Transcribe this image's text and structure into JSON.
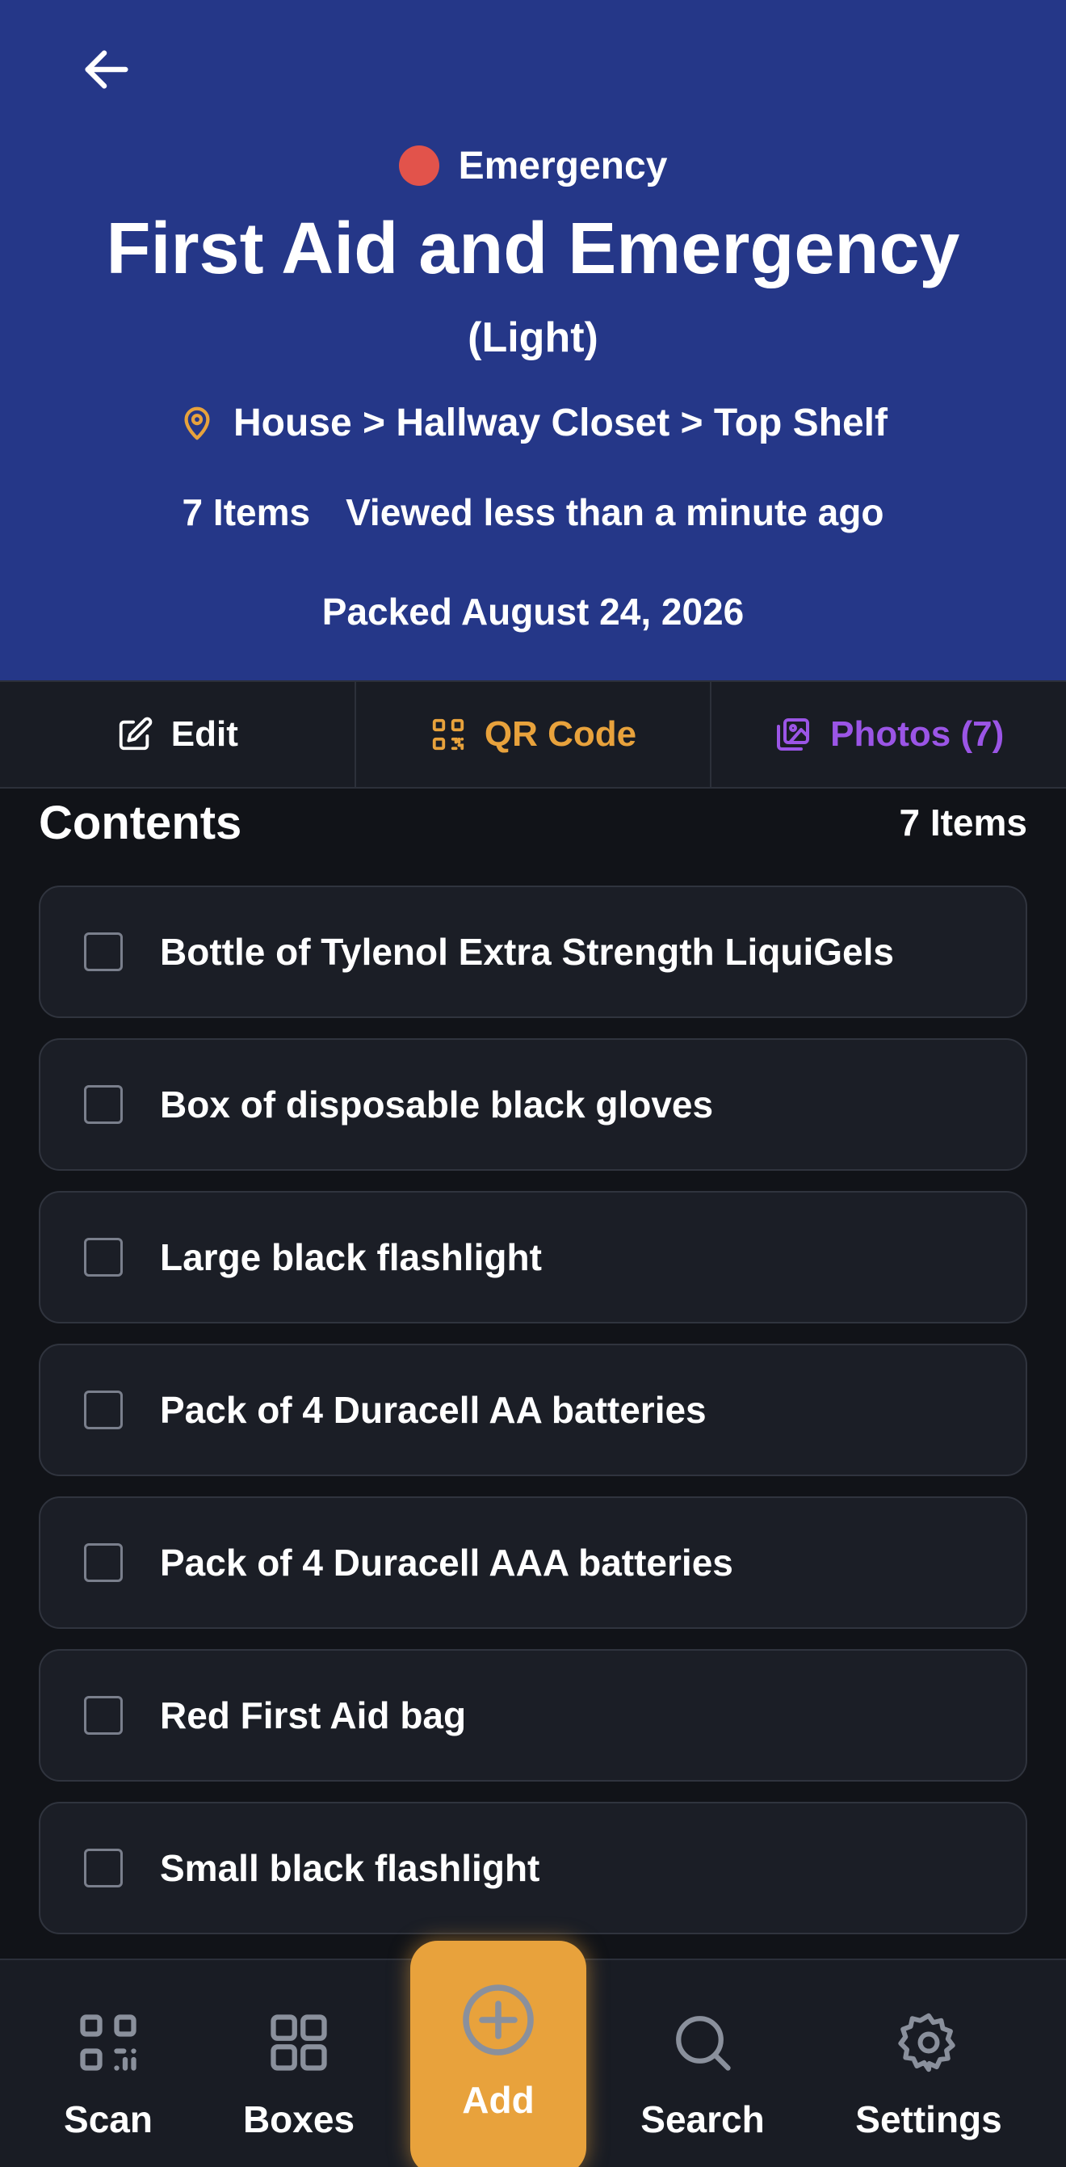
{
  "header": {
    "category": "Emergency",
    "category_color": "#e2534b",
    "title": "First Aid and Emergency",
    "subtitle": "(Light)",
    "location": "House > Hallway Closet > Top Shelf",
    "item_count": "7 Items",
    "viewed": "Viewed less than a minute ago",
    "packed": "Packed August 24, 2026",
    "background_color": "#253788"
  },
  "actions": {
    "edit_label": "Edit",
    "qr_label": "QR Code",
    "photos_label": "Photos (7)",
    "qr_color": "#e8a23c",
    "photos_color": "#9b55e6"
  },
  "contents": {
    "title": "Contents",
    "count": "7 Items",
    "items": [
      {
        "label": "Bottle of Tylenol Extra Strength LiquiGels",
        "checked": false
      },
      {
        "label": "Box of disposable black gloves",
        "checked": false
      },
      {
        "label": "Large black flashlight",
        "checked": false
      },
      {
        "label": "Pack of 4 Duracell AA batteries",
        "checked": false
      },
      {
        "label": "Pack of 4 Duracell AAA batteries",
        "checked": false
      },
      {
        "label": "Red First Aid bag",
        "checked": false
      },
      {
        "label": "Small black flashlight",
        "checked": false
      }
    ]
  },
  "nav": {
    "scan": "Scan",
    "boxes": "Boxes",
    "add": "Add",
    "search": "Search",
    "settings": "Settings",
    "accent_color": "#e8a23c"
  },
  "icons": {
    "back": "arrow-left-icon",
    "location": "map-pin-icon",
    "edit": "pencil-square-icon",
    "qr": "qr-code-icon",
    "photos": "images-icon",
    "scan": "qr-scan-icon",
    "boxes": "grid-icon",
    "add": "plus-circle-icon",
    "search": "search-icon",
    "settings": "gear-icon"
  }
}
